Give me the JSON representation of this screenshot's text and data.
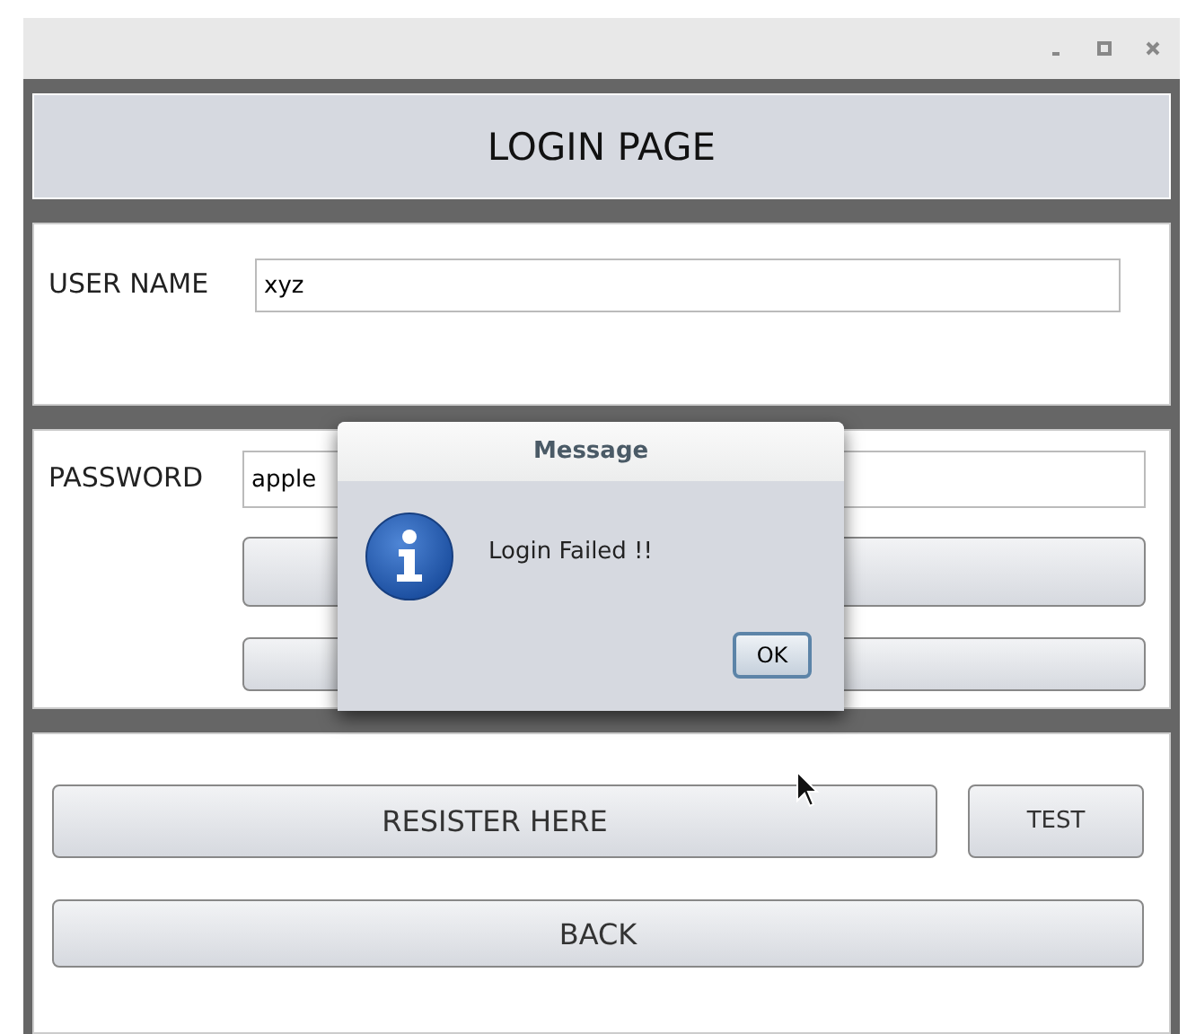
{
  "window": {
    "controls": [
      {
        "kind": "minimize"
      },
      {
        "kind": "maximize"
      },
      {
        "kind": "close"
      }
    ]
  },
  "header": {
    "title": "LOGIN PAGE"
  },
  "user_panel": {
    "label": "USER NAME",
    "value": "xyz"
  },
  "password_panel": {
    "label": "PASSWORD",
    "value": "apple",
    "buttons": [
      {
        "kind": "button"
      },
      {
        "kind": "button"
      }
    ]
  },
  "actions": {
    "register": "RESISTER HERE",
    "test": "TEST",
    "back": "BACK"
  },
  "dialog": {
    "title": "Message",
    "message": "Login Failed !!",
    "kind": "info",
    "button": "OK"
  },
  "cursor": {
    "kind": "arrow"
  }
}
